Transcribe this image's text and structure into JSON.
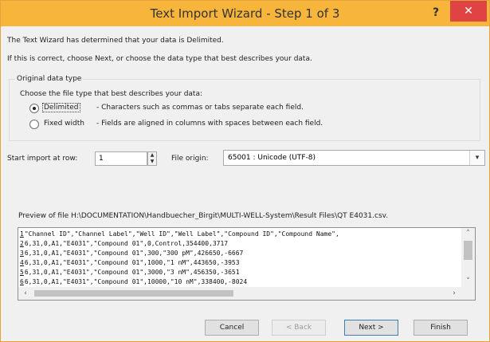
{
  "window": {
    "title": "Text Import Wizard - Step 1 of 3",
    "help_symbol": "?",
    "close_symbol": "✕"
  },
  "intro": {
    "line1": "The Text Wizard has determined that your data is Delimited.",
    "line2": "If this is correct, choose Next, or choose the data type that best describes your data."
  },
  "original_data_type": {
    "group_label": "Original data type",
    "prompt": "Choose the file type that best describes your data:",
    "options": [
      {
        "label": "Delimited",
        "description": "- Characters such as commas or tabs separate each field.",
        "selected": true
      },
      {
        "label": "Fixed width",
        "description": "- Fields are aligned in columns with spaces between each field.",
        "selected": false
      }
    ]
  },
  "start_row": {
    "label": "Start import at row:",
    "value": "1"
  },
  "file_origin": {
    "label": "File origin:",
    "value": "65001 : Unicode (UTF-8)"
  },
  "preview": {
    "label": "Preview of file H:\\DOCUMENTATION\\Handbuecher_Birgit\\MULTI-WELL-System\\Result Files\\QT E4031.csv.",
    "lines": [
      {
        "num": "1",
        "text": "\"Channel ID\",\"Channel Label\",\"Well ID\",\"Well Label\",\"Compound ID\",\"Compound Name\","
      },
      {
        "num": "2",
        "text": "6,31,0,A1,\"E4031\",\"Compound 01\",0,Control,354400,3717"
      },
      {
        "num": "3",
        "text": "6,31,0,A1,\"E4031\",\"Compound 01\",300,\"300 pM\",426650,-6667"
      },
      {
        "num": "4",
        "text": "6,31,0,A1,\"E4031\",\"Compound 01\",1000,\"1 nM\",443650,-3953"
      },
      {
        "num": "5",
        "text": "6,31,0,A1,\"E4031\",\"Compound 01\",3000,\"3 nM\",456350,-3651"
      },
      {
        "num": "6",
        "text": "6,31,0,A1,\"E4031\",\"Compound 01\",10000,\"10 nM\",338400,-8024"
      }
    ]
  },
  "buttons": {
    "cancel": "Cancel",
    "back": "< Back",
    "next": "Next >",
    "finish": "Finish"
  },
  "colors": {
    "titlebar": "#f7b53c",
    "close": "#e04343"
  },
  "icons": {
    "spinner": "spinner-arrows-icon",
    "dropdown": "chevron-down-icon"
  }
}
